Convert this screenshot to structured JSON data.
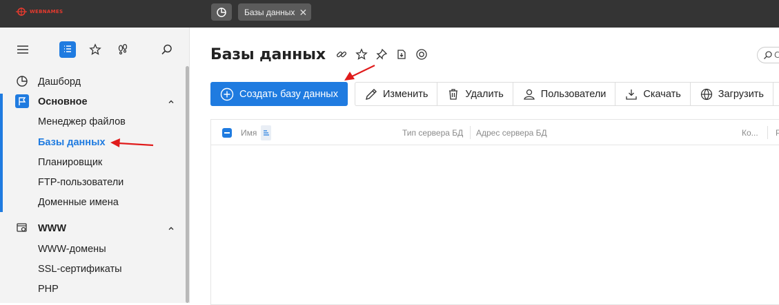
{
  "app": {
    "logo_text": "WEBNAMES"
  },
  "topbar": {
    "tab_label": "Базы данных",
    "tab_close": "✕"
  },
  "sidebar": {
    "items": [
      {
        "label": "Дашборд"
      },
      {
        "label": "Основное"
      },
      {
        "label": "Менеджер файлов"
      },
      {
        "label": "Базы данных"
      },
      {
        "label": "Планировщик"
      },
      {
        "label": "FTP-пользователи"
      },
      {
        "label": "Доменные имена"
      },
      {
        "label": "WWW"
      },
      {
        "label": "WWW-домены"
      },
      {
        "label": "SSL-сертификаты"
      },
      {
        "label": "PHP"
      }
    ]
  },
  "main": {
    "title": "Базы данных",
    "search_hint": "С",
    "create_label": "Создать базу данных",
    "toolbar": {
      "edit": "Изменить",
      "delete": "Удалить",
      "users": "Пользователи",
      "download": "Скачать",
      "upload": "Загрузить"
    },
    "table": {
      "columns": {
        "name": "Имя",
        "server_type": "Тип сервера БД",
        "server_address": "Адрес сервера БД",
        "count": "Ко...",
        "extra": "Р"
      }
    }
  },
  "colors": {
    "accent": "#1f7be0",
    "topbar": "#343434",
    "annotation": "#e01b1b"
  }
}
